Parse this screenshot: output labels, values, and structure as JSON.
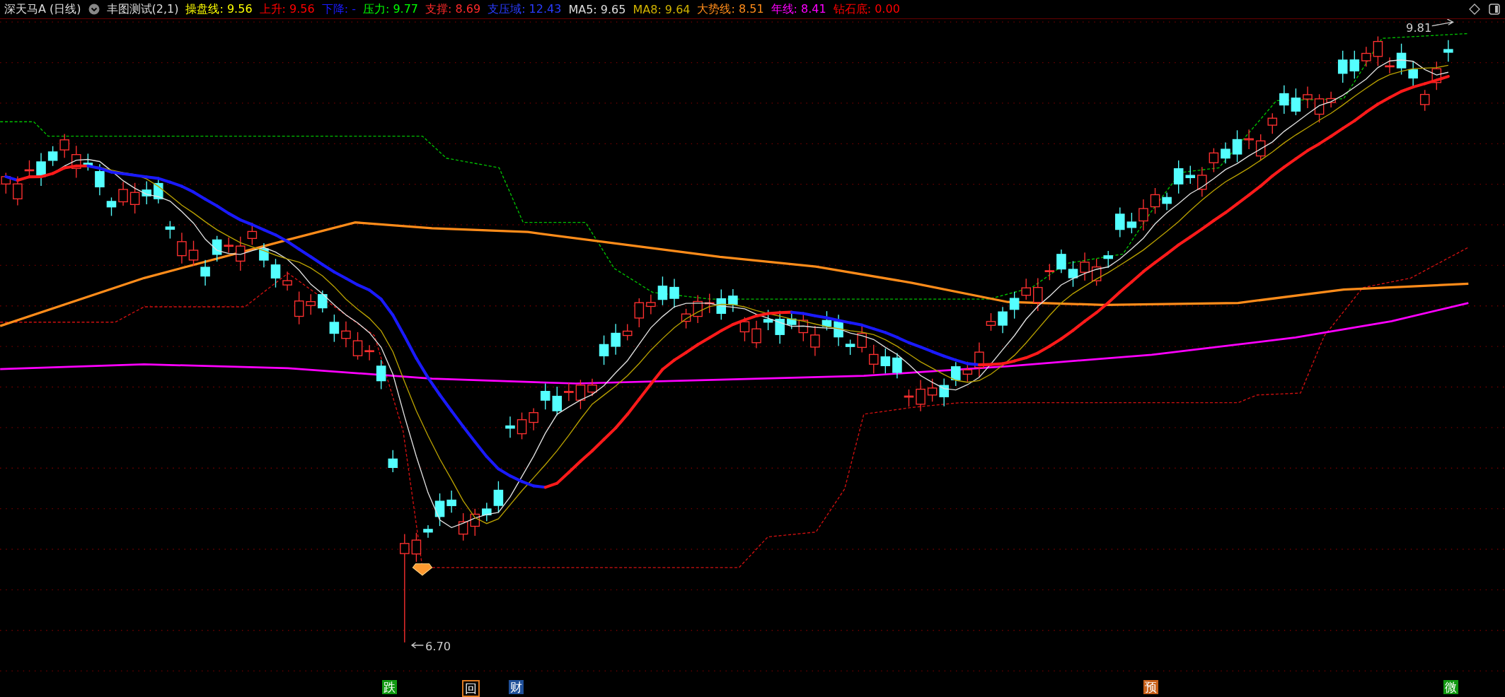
{
  "header": {
    "stock": "深天马A",
    "period": "(日线)",
    "indicator": "丰图测试(2,1)",
    "readings": [
      {
        "text": "操盘线: 9.56",
        "color": "#ffff00"
      },
      {
        "text": "上升: 9.56",
        "color": "#ff0000"
      },
      {
        "text": "下降: -",
        "color": "#1a1aff"
      },
      {
        "text": "压力: 9.77",
        "color": "#00ff00"
      },
      {
        "text": "支撑: 8.69",
        "color": "#ff2a2a"
      },
      {
        "text": "支压域: 12.43",
        "color": "#2a3cff"
      },
      {
        "text": "MA5: 9.65",
        "color": "#dddddd"
      },
      {
        "text": "MA8: 9.64",
        "color": "#d2b400"
      },
      {
        "text": "大势线: 8.51",
        "color": "#ff8c1a"
      },
      {
        "text": "年线: 8.41",
        "color": "#ff00ff"
      },
      {
        "text": "钻石底: 0.00",
        "color": "#ff0000"
      }
    ]
  },
  "chart": {
    "high_label": "9.81",
    "low_label": "6.70"
  },
  "signals": [
    {
      "text": "跌",
      "kind": "filled",
      "color": "#119911"
    },
    {
      "text": "回",
      "kind": "boxed",
      "color": "#e07a20"
    },
    {
      "text": "财",
      "kind": "filled",
      "color": "#1f4f99"
    },
    {
      "text": "预",
      "kind": "filled",
      "color": "#c8601a"
    },
    {
      "text": "微",
      "kind": "filled",
      "color": "#119911"
    }
  ]
}
